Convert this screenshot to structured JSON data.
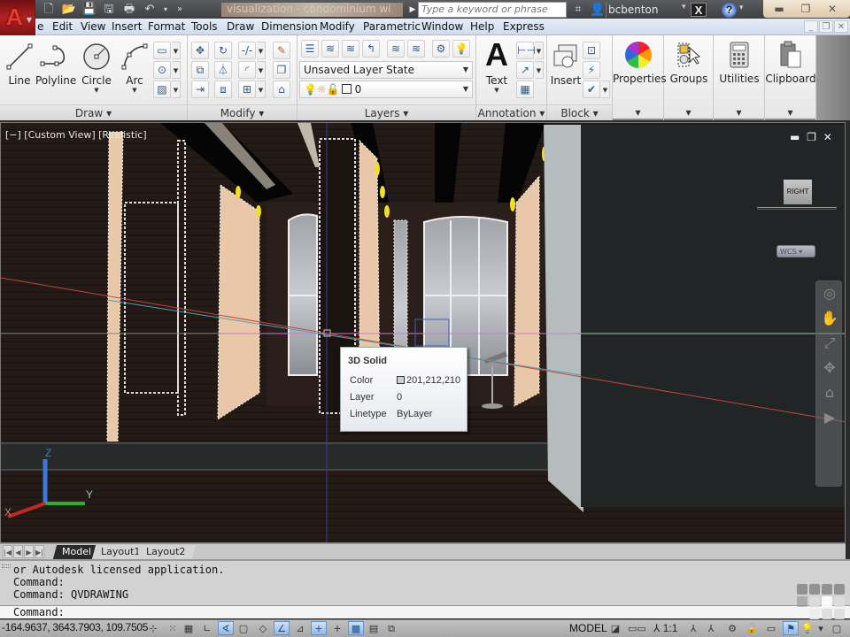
{
  "app": {
    "title": "visualization - condominium wi",
    "search_placeholder": "Type a keyword or phrase",
    "username": "bcbenton"
  },
  "quick_access": [
    "new-icon",
    "open-icon",
    "save-icon",
    "saveas-icon",
    "plot-icon",
    "undo-icon",
    "undo-dropdown",
    "more-icon"
  ],
  "menu": [
    "e",
    "Edit",
    "View",
    "Insert",
    "Format",
    "Tools",
    "Draw",
    "Dimension",
    "Modify",
    "Parametric",
    "Window",
    "Help",
    "Express"
  ],
  "ribbon": {
    "draw": {
      "title": "Draw",
      "line": "Line",
      "polyline": "Polyline",
      "circle": "Circle",
      "arc": "Arc"
    },
    "modify": {
      "title": "Modify"
    },
    "layers": {
      "title": "Layers",
      "layer_state": "Unsaved Layer State",
      "current_layer": "0"
    },
    "annotation": {
      "title": "Annotation",
      "text": "Text"
    },
    "block": {
      "title": "Block",
      "insert": "Insert"
    },
    "properties": {
      "label": "Properties"
    },
    "groups": {
      "label": "Groups"
    },
    "utilities": {
      "label": "Utilities"
    },
    "clipboard": {
      "label": "Clipboard"
    }
  },
  "viewport": {
    "label": "[−] [Custom View] [Realistic]",
    "viewcube_face": "RIGHT",
    "ucs_menu": "WCS",
    "axis_x": "X",
    "axis_y": "Y",
    "axis_z": "Z"
  },
  "tooltip": {
    "title": "3D Solid",
    "rows": [
      {
        "key": "Color",
        "value": "201,212,210"
      },
      {
        "key": "Layer",
        "value": "0"
      },
      {
        "key": "Linetype",
        "value": "ByLayer"
      }
    ],
    "swatch_color": "#c9d4d2"
  },
  "layout_tabs": [
    "Model",
    "Layout1",
    "Layout2"
  ],
  "command_line": {
    "history": [
      "or Autodesk licensed application.",
      "Command:",
      "Command: QVDRAWING"
    ],
    "prompt": "Command:"
  },
  "status": {
    "coordinates": "-164.9637, 3643.7903, 109.7505",
    "space": "MODEL",
    "annotation_scale": "1:1"
  },
  "colors": {
    "accent": "#3c6ed0",
    "tooltip_swatch": "#c9d4d2"
  }
}
